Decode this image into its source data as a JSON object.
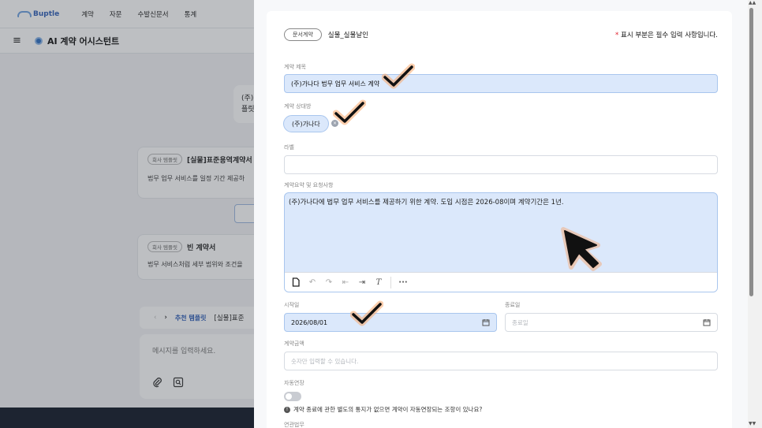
{
  "nav": {
    "brand": "Buptle",
    "items": [
      "계약",
      "자문",
      "수발신문서",
      "통계"
    ]
  },
  "subbar": {
    "title": "AI 계약 어시스턴트"
  },
  "chat": {
    "bubble_line1": "(주)",
    "bubble_line2": "플릿"
  },
  "template_cards": [
    {
      "badge": "회사 템플릿",
      "title": "[실물]표준용역계약서",
      "desc": "법무 업무 서비스를 일정 기간 제공하"
    },
    {
      "badge": "회사 템플릿",
      "title": "빈 계약서",
      "desc": "법무 서비스처럼 세부 범위와 조건을"
    }
  ],
  "recommend": {
    "label": "추천 템플릿",
    "value": "[실물]표준"
  },
  "message": {
    "placeholder": "메시지를 입력하세요."
  },
  "form": {
    "type_badge": "문서계약",
    "template_name": "실물_실물날인",
    "required_star": "*",
    "required_note": "표시 부분은 필수 입력 사항입니다.",
    "title_label": "계약 제목",
    "title_value": "(주)가나다 법무 업무 서비스 계약",
    "party_label": "계약 상대방",
    "party_chip": "(주)가나다",
    "label_label": "라벨",
    "label_value": "",
    "summary_label": "계약요약 및 요청사항",
    "summary_value": "(주)가나다에 법무 업무 서비스를 제공하기 위한 계약. 도입 시점은 2026-08이며 계약기간은 1년.",
    "start_label": "시작일",
    "start_value": "2026/08/01",
    "end_label": "종료일",
    "end_placeholder": "종료일",
    "amount_label": "계약금액",
    "amount_placeholder": "숫자만 입력할 수 있습니다.",
    "auto_label": "자동연장",
    "auto_enabled": false,
    "auto_info": "계약 종료에 관한 별도의 통지가 없으면 계약이 자동연장되는 조항이 있나요?",
    "next_label": "연관법무"
  },
  "icons": {
    "editor_toolbar": [
      "document-icon",
      "undo-icon",
      "redo-icon",
      "outdent-icon",
      "indent-icon",
      "clear-format-icon",
      "more-icon"
    ]
  },
  "colors": {
    "highlight": "#dbe8fb",
    "accent": "#2f5fb8",
    "check_mark": "#111111",
    "check_glow": "#f7a56a",
    "required": "#e11d2a"
  }
}
